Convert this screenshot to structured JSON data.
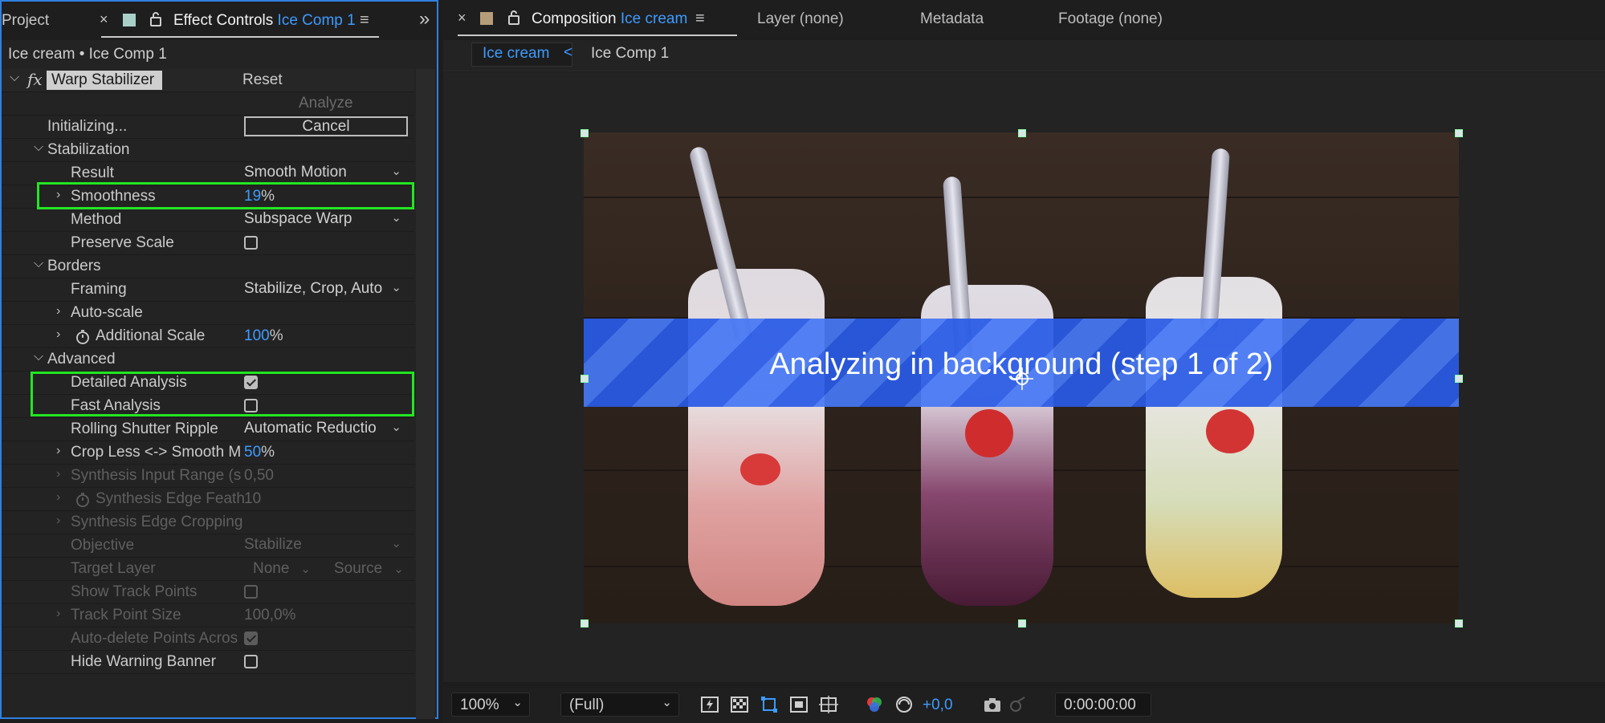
{
  "left_panel": {
    "tabs": {
      "project": "Project",
      "close": "×",
      "effect_controls_prefix": "Effect Controls",
      "effect_controls_target": "Ice Comp 1",
      "menu": "≡",
      "overflow": "»"
    },
    "breadcrumb": "Ice cream • Ice Comp 1",
    "effect": {
      "fx_glyph": "fx",
      "name": "Warp Stabilizer",
      "reset": "Reset",
      "analyze": "Analyze",
      "status": "Initializing...",
      "cancel": "Cancel"
    },
    "stabilization": {
      "header": "Stabilization",
      "result_label": "Result",
      "result_value": "Smooth Motion",
      "smoothness_label": "Smoothness",
      "smoothness_value": "19",
      "smoothness_unit": "%",
      "method_label": "Method",
      "method_value": "Subspace Warp",
      "preserve_scale_label": "Preserve Scale",
      "preserve_scale_checked": false
    },
    "borders": {
      "header": "Borders",
      "framing_label": "Framing",
      "framing_value": "Stabilize, Crop, Auto",
      "auto_scale_label": "Auto-scale",
      "additional_scale_label": "Additional Scale",
      "additional_scale_value": "100",
      "additional_scale_unit": "%"
    },
    "advanced": {
      "header": "Advanced",
      "detailed_analysis_label": "Detailed Analysis",
      "detailed_analysis_checked": true,
      "fast_analysis_label": "Fast Analysis",
      "fast_analysis_checked": false,
      "rolling_shutter_label": "Rolling Shutter Ripple",
      "rolling_shutter_value": "Automatic Reductio",
      "crop_less_label": "Crop Less <-> Smooth M",
      "crop_less_value": "50",
      "crop_less_unit": "%",
      "synthesis_input_label": "Synthesis Input Range (s",
      "synthesis_input_value": "0,50",
      "synthesis_edge_feather_label": "Synthesis Edge Feath",
      "synthesis_edge_feather_value": "10",
      "synthesis_edge_cropping_label": "Synthesis Edge Cropping",
      "objective_label": "Objective",
      "objective_value": "Stabilize",
      "target_layer_label": "Target Layer",
      "target_layer_value": "None",
      "target_layer_source": "Source",
      "show_track_points_label": "Show Track Points",
      "track_point_size_label": "Track Point Size",
      "track_point_size_value": "100,0%",
      "auto_delete_label": "Auto-delete Points Acros",
      "hide_warning_label": "Hide Warning Banner"
    }
  },
  "right_panel": {
    "tabs": {
      "close": "×",
      "composition_prefix": "Composition",
      "composition_target": "Ice cream",
      "menu": "≡",
      "layer": "Layer (none)",
      "metadata": "Metadata",
      "footage": "Footage (none)"
    },
    "comp_tabs": {
      "active": "Ice cream",
      "arrow": "<",
      "other": "Ice Comp 1"
    },
    "banner_text": "Analyzing in background (step 1 of 2)",
    "bottom_bar": {
      "zoom": "100%",
      "resolution": "(Full)",
      "exposure": "+0,0",
      "timecode": "0:00:00:00"
    }
  },
  "colors": {
    "accent_blue": "#3d9bff",
    "highlight_green": "#22e622",
    "banner_blue": "#285ae6",
    "panel_border": "#2f7fe0"
  }
}
